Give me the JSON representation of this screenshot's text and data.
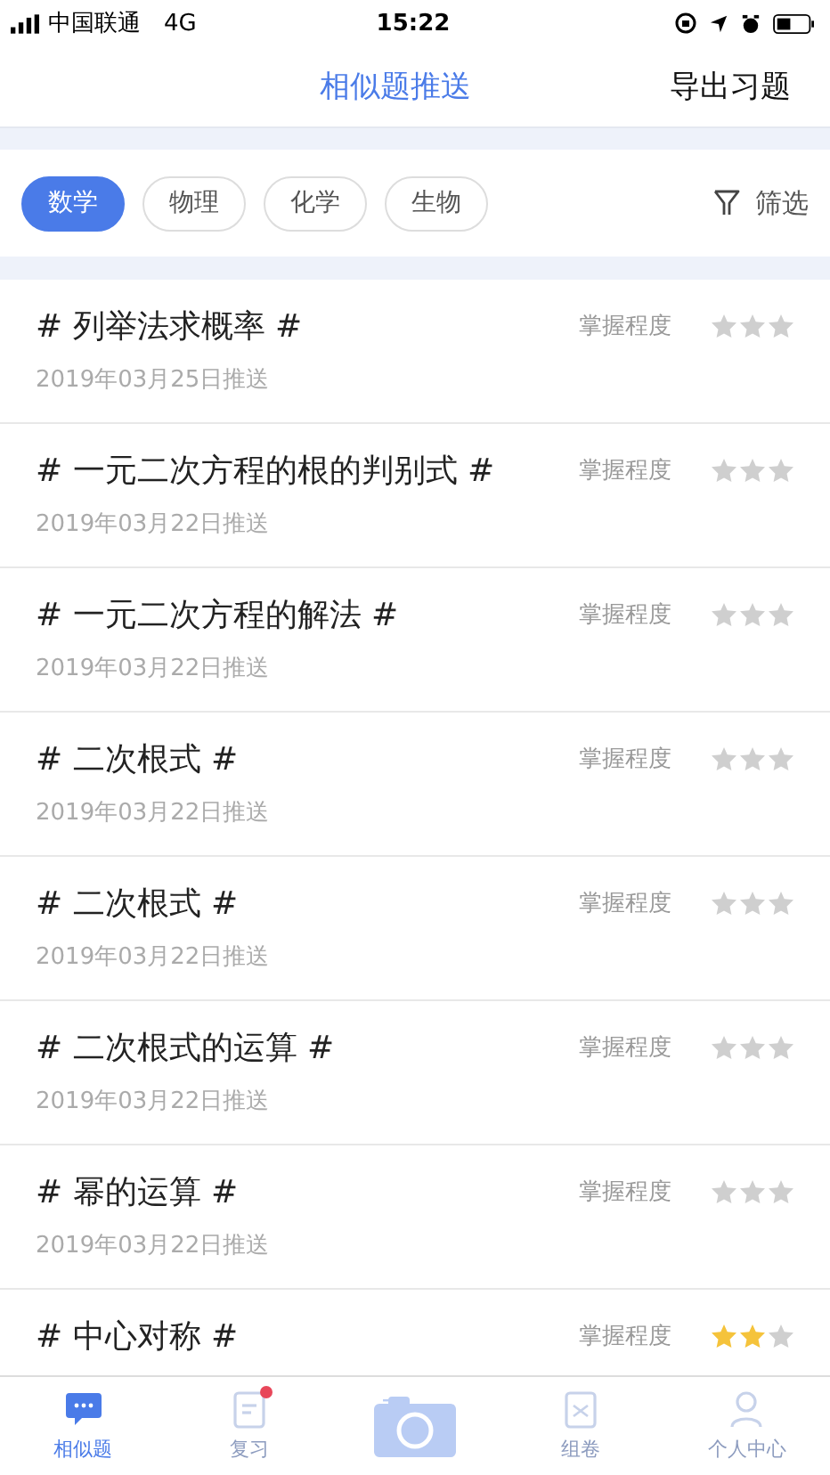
{
  "status_bar": {
    "carrier": "中国联通",
    "network": "4G",
    "time": "15:22"
  },
  "nav": {
    "title": "相似题推送",
    "action": "导出习题"
  },
  "subjects": [
    {
      "label": "数学",
      "selected": true
    },
    {
      "label": "物理",
      "selected": false
    },
    {
      "label": "化学",
      "selected": false
    },
    {
      "label": "生物",
      "selected": false
    }
  ],
  "filter": {
    "label": "筛选"
  },
  "items": [
    {
      "title": "# 列举法求概率 #",
      "mastery_label": "掌握程度",
      "stars": 0,
      "date": "2019年03月25日推送"
    },
    {
      "title": "# 一元二次方程的根的判别式 #",
      "mastery_label": "掌握程度",
      "stars": 0,
      "date": "2019年03月22日推送"
    },
    {
      "title": "# 一元二次方程的解法 #",
      "mastery_label": "掌握程度",
      "stars": 0,
      "date": "2019年03月22日推送"
    },
    {
      "title": "# 二次根式 #",
      "mastery_label": "掌握程度",
      "stars": 0,
      "date": "2019年03月22日推送"
    },
    {
      "title": "# 二次根式 #",
      "mastery_label": "掌握程度",
      "stars": 0,
      "date": "2019年03月22日推送"
    },
    {
      "title": "# 二次根式的运算 #",
      "mastery_label": "掌握程度",
      "stars": 0,
      "date": "2019年03月22日推送"
    },
    {
      "title": "# 幂的运算 #",
      "mastery_label": "掌握程度",
      "stars": 0,
      "date": "2019年03月22日推送"
    },
    {
      "title": "# 中心对称 #",
      "mastery_label": "掌握程度",
      "stars": 2
    }
  ],
  "tab_bar": [
    {
      "kind": "chat",
      "label": "相似题",
      "selected": true
    },
    {
      "kind": "doc",
      "label": "复习",
      "selected": false,
      "badge": true
    },
    {
      "kind": "camera"
    },
    {
      "kind": "paper",
      "label": "组卷",
      "selected": false
    },
    {
      "kind": "person",
      "label": "个人中心",
      "selected": false
    }
  ]
}
